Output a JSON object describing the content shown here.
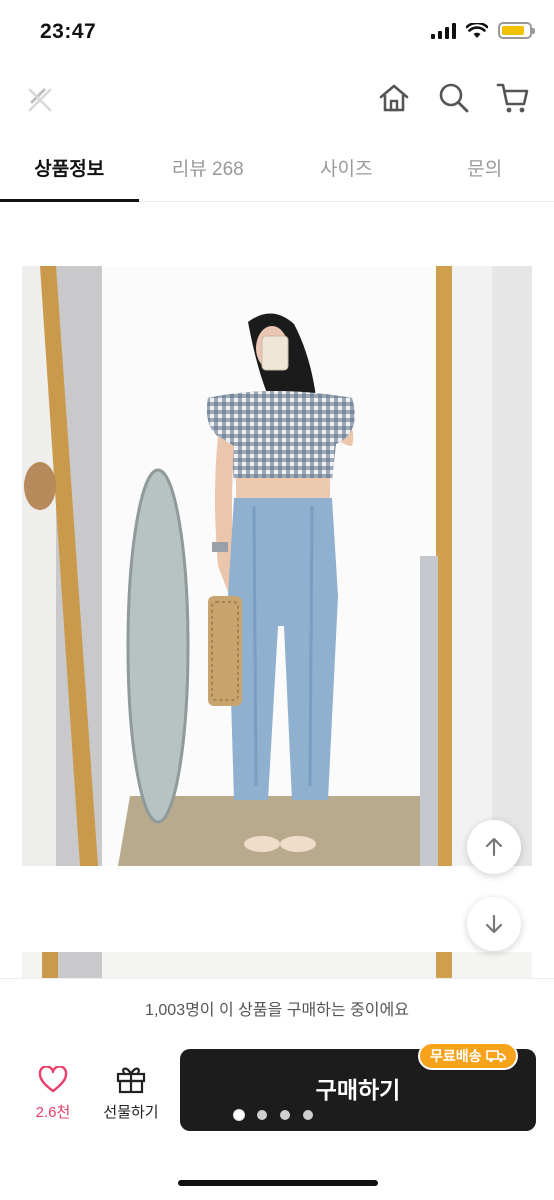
{
  "status_bar": {
    "time": "23:47",
    "battery_level": 0.85,
    "colors": {
      "battery_fill": "#f2c200"
    }
  },
  "header": {
    "icons": [
      "back-chevron-icon",
      "home-icon",
      "search-icon",
      "cart-icon"
    ]
  },
  "tabs": [
    {
      "label": "상품정보",
      "active": true
    },
    {
      "label": "리뷰 268",
      "active": false
    },
    {
      "label": "사이즈",
      "active": false
    },
    {
      "label": "문의",
      "active": false
    }
  ],
  "product_image": {
    "subject": "mirror selfie photo"
  },
  "floating_buttons": {
    "up_icon": "arrow-up-icon",
    "down_icon": "arrow-down-icon"
  },
  "buying_banner": {
    "text": "1,003명이 이 상품을 구매하는 중이에요"
  },
  "bottom_bar": {
    "like_count": "2.6천",
    "gift_label": "선물하기",
    "buy_label": "구매하기",
    "free_shipping_badge": "무료배송",
    "carousel_page": 1,
    "carousel_total": 4,
    "colors": {
      "like": "#e8406a",
      "buy_button": "#1c1c1c",
      "badge": "#f7a21b"
    }
  }
}
